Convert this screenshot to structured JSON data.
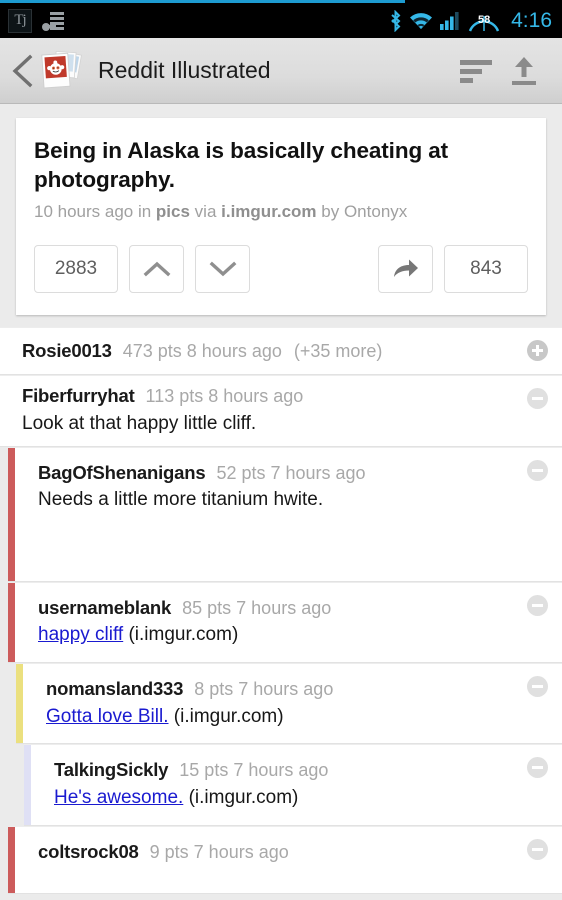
{
  "status_bar": {
    "notification_icons": [
      "tj-icon",
      "playlist-icon"
    ],
    "tj_label": "Tj",
    "system_icons": [
      "bluetooth-icon",
      "wifi-icon",
      "signal-icon",
      "battery-icon"
    ],
    "battery_percent": "58",
    "time": "4:16",
    "accent_color": "#35b8e8"
  },
  "action_bar": {
    "back_label": "Back",
    "title": "Reddit Illustrated",
    "sort_label": "Sort",
    "upload_label": "Upload"
  },
  "post": {
    "title": "Being in Alaska is basically cheating at photography.",
    "meta_time": "10 hours ago in ",
    "meta_subreddit": "pics",
    "meta_via": " via ",
    "meta_domain": "i.imgur.com",
    "meta_by": " by Ontonyx",
    "score": "2883",
    "upvote_label": "Upvote",
    "downvote_label": "Downvote",
    "share_label": "Share",
    "comment_count": "843"
  },
  "comments": [
    {
      "user": "Rosie0013",
      "info": "473 pts 8 hours ago",
      "more": "(+35 more)",
      "body": "",
      "link": "",
      "domain": "",
      "depth": 0,
      "collapsed": true,
      "toggle": "plus",
      "bar_color": ""
    },
    {
      "user": "Fiberfurryhat",
      "info": "113 pts 8 hours ago",
      "more": "",
      "body": "Look at that happy little cliff.",
      "link": "",
      "domain": "",
      "depth": 0,
      "collapsed": false,
      "toggle": "minus",
      "bar_color": ""
    },
    {
      "user": "BagOfShenanigans",
      "info": "52 pts 7 hours ago",
      "more": "",
      "body": "Needs a little more titanium hwite.",
      "link": "",
      "domain": "",
      "depth": 1,
      "collapsed": false,
      "toggle": "minus",
      "bar_color": "#cc5b5b"
    },
    {
      "user": "usernameblank",
      "info": "85 pts 7 hours ago",
      "more": "",
      "body": "",
      "link": "happy cliff",
      "domain": " (i.imgur.com)",
      "depth": 1,
      "collapsed": false,
      "toggle": "minus",
      "bar_color": "#cc5b5b"
    },
    {
      "user": "nomansland333",
      "info": "8 pts 7 hours ago",
      "more": "",
      "body": "",
      "link": "Gotta love Bill.",
      "domain": " (i.imgur.com)",
      "depth": 2,
      "collapsed": false,
      "toggle": "minus",
      "bar_color": "#ebe07f"
    },
    {
      "user": "TalkingSickly",
      "info": "15 pts 7 hours ago",
      "more": "",
      "body": "",
      "link": "He's awesome.",
      "domain": " (i.imgur.com)",
      "depth": 3,
      "collapsed": false,
      "toggle": "minus",
      "bar_color": "#dfe0f5"
    },
    {
      "user": "coltsrock08",
      "info": "9 pts 7 hours ago",
      "more": "",
      "body": "",
      "link": "",
      "domain": "",
      "depth": 1,
      "collapsed": false,
      "toggle": "minus",
      "bar_color": "#cc5b5b"
    }
  ]
}
